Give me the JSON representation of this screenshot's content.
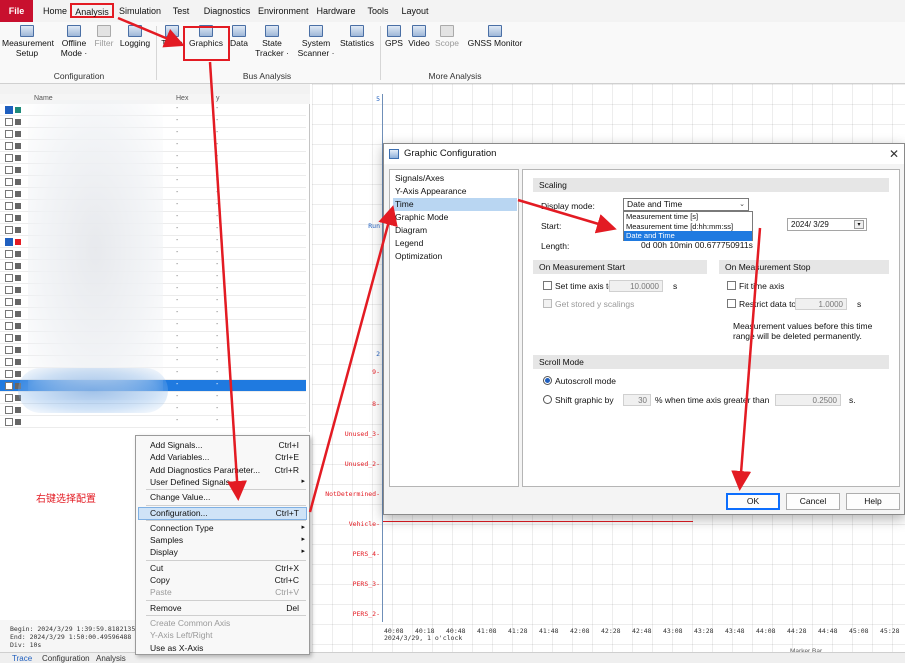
{
  "menu": {
    "file": "File",
    "items": [
      "Home",
      "Analysis",
      "Simulation",
      "Test",
      "Diagnostics",
      "Environment",
      "Hardware",
      "Tools",
      "Layout"
    ]
  },
  "ribbon": {
    "buttons": [
      {
        "label": "Measurement\nSetup",
        "enabled": true
      },
      {
        "label": "Offline\nMode ·",
        "enabled": true
      },
      {
        "label": "Filter",
        "enabled": false
      },
      {
        "label": "Logging",
        "enabled": true
      },
      {
        "label": "Trace",
        "enabled": true
      },
      {
        "label": "Graphics",
        "enabled": true
      },
      {
        "label": "Data",
        "enabled": true
      },
      {
        "label": "State\nTracker ·",
        "enabled": true
      },
      {
        "label": "System\nScanner ·",
        "enabled": true
      },
      {
        "label": "Statistics",
        "enabled": true
      },
      {
        "label": "GPS",
        "enabled": true
      },
      {
        "label": "Video",
        "enabled": true
      },
      {
        "label": "Scope",
        "enabled": false
      },
      {
        "label": "GNSS Monitor",
        "enabled": true
      }
    ],
    "groups": [
      "Configuration",
      "Bus Analysis",
      "More Analysis"
    ]
  },
  "signal_list": {
    "headers": [
      "Name",
      "Hex",
      "y"
    ],
    "rows": 27
  },
  "context_menu": {
    "items": [
      {
        "label": "Add Signals...",
        "shortcut": "Ctrl+I",
        "enabled": true
      },
      {
        "label": "Add Variables...",
        "shortcut": "Ctrl+E",
        "enabled": true
      },
      {
        "label": "Add Diagnostics Parameter...",
        "shortcut": "Ctrl+R",
        "enabled": true
      },
      {
        "label": "User Defined Signals",
        "shortcut": "",
        "submenu": true,
        "enabled": true
      },
      {
        "label": "Change Value...",
        "shortcut": "",
        "enabled": true
      },
      {
        "label": "Configuration...",
        "shortcut": "Ctrl+T",
        "enabled": true,
        "selected": true
      },
      {
        "label": "Connection Type",
        "shortcut": "",
        "submenu": true,
        "enabled": true
      },
      {
        "label": "Samples",
        "shortcut": "",
        "submenu": true,
        "enabled": true
      },
      {
        "label": "Display",
        "shortcut": "",
        "submenu": true,
        "enabled": true
      },
      {
        "label": "Cut",
        "shortcut": "Ctrl+X",
        "enabled": true
      },
      {
        "label": "Copy",
        "shortcut": "Ctrl+C",
        "enabled": true
      },
      {
        "label": "Paste",
        "shortcut": "Ctrl+V",
        "enabled": false
      },
      {
        "label": "Remove",
        "shortcut": "Del",
        "enabled": true
      },
      {
        "label": "Create Common Axis",
        "shortcut": "",
        "enabled": false
      },
      {
        "label": "Y-Axis Left/Right",
        "shortcut": "",
        "enabled": false
      },
      {
        "label": "Use as X-Axis",
        "shortcut": "",
        "enabled": true
      }
    ]
  },
  "annotation_note": "右键选择配置",
  "info": {
    "begin": "Begin: 2024/3/29 1:39:59.81821357",
    "end": "End: 2024/3/29 1:50:00.49596488",
    "div": "Div: 10s"
  },
  "bottom_tabs": [
    "Trace",
    "Configuration",
    "Analysis"
  ],
  "graph": {
    "axis_labels": [
      "5",
      "Run",
      "2",
      "9-",
      "8-",
      "Unused_3-",
      "Unused_2-",
      "NotDetermined-",
      "Vehicle-",
      "PERS_4-",
      "PERS_3-",
      "PERS_2-"
    ],
    "x_ticks": [
      "40:08",
      "40:18",
      "40:48",
      "41:08",
      "41:28",
      "41:48",
      "42:08",
      "42:28",
      "42:48",
      "43:08",
      "43:28",
      "43:48",
      "44:08",
      "44:28",
      "44:48",
      "45:08",
      "45:28"
    ],
    "x_date": "2024/3/29, 1 o'clock",
    "marker_label": "Marker Bar"
  },
  "dialog": {
    "title": "Graphic Configuration",
    "nav": [
      "Signals/Axes",
      "Y-Axis Appearance",
      "Time",
      "Graphic Mode",
      "Diagram",
      "Legend",
      "Optimization"
    ],
    "nav_selected": "Time",
    "scaling": {
      "header": "Scaling",
      "display_mode_label": "Display mode:",
      "display_mode_value": "Date and Time",
      "options": [
        "Measurement time [s]",
        "Measurement time [d:hh:mm:ss]",
        "Date and Time"
      ],
      "start_label": "Start:",
      "start_date": "2024/  3/29",
      "length_label": "Length:",
      "length_value": "0d 00h 10min 00.677750911s"
    },
    "measurement_start": {
      "header": "On Measurement Start",
      "set_time_axis_label": "Set time axis to",
      "set_time_axis_value": "10.0000",
      "set_time_axis_unit": "s",
      "stored_y_label": "Get stored y scalings"
    },
    "measurement_stop": {
      "header": "On Measurement Stop",
      "fit_label": "Fit time axis",
      "restrict_label": "Restrict data to",
      "restrict_value": "1.0000",
      "restrict_unit": "s",
      "note": "Measurement values before this time range will be deleted permanently."
    },
    "scroll_mode": {
      "header": "Scroll Mode",
      "autoscroll_label": "Autoscroll mode",
      "shift_label": "Shift graphic by",
      "shift_value": "30",
      "shift_mid": "%  when time axis greater than",
      "shift_time": "0.2500",
      "shift_unit": "s."
    },
    "buttons": {
      "ok": "OK",
      "cancel": "Cancel",
      "help": "Help"
    }
  },
  "colors": {
    "accent": "#e31b23",
    "file_menu": "#c8102e",
    "selection": "#1f7ae0"
  }
}
